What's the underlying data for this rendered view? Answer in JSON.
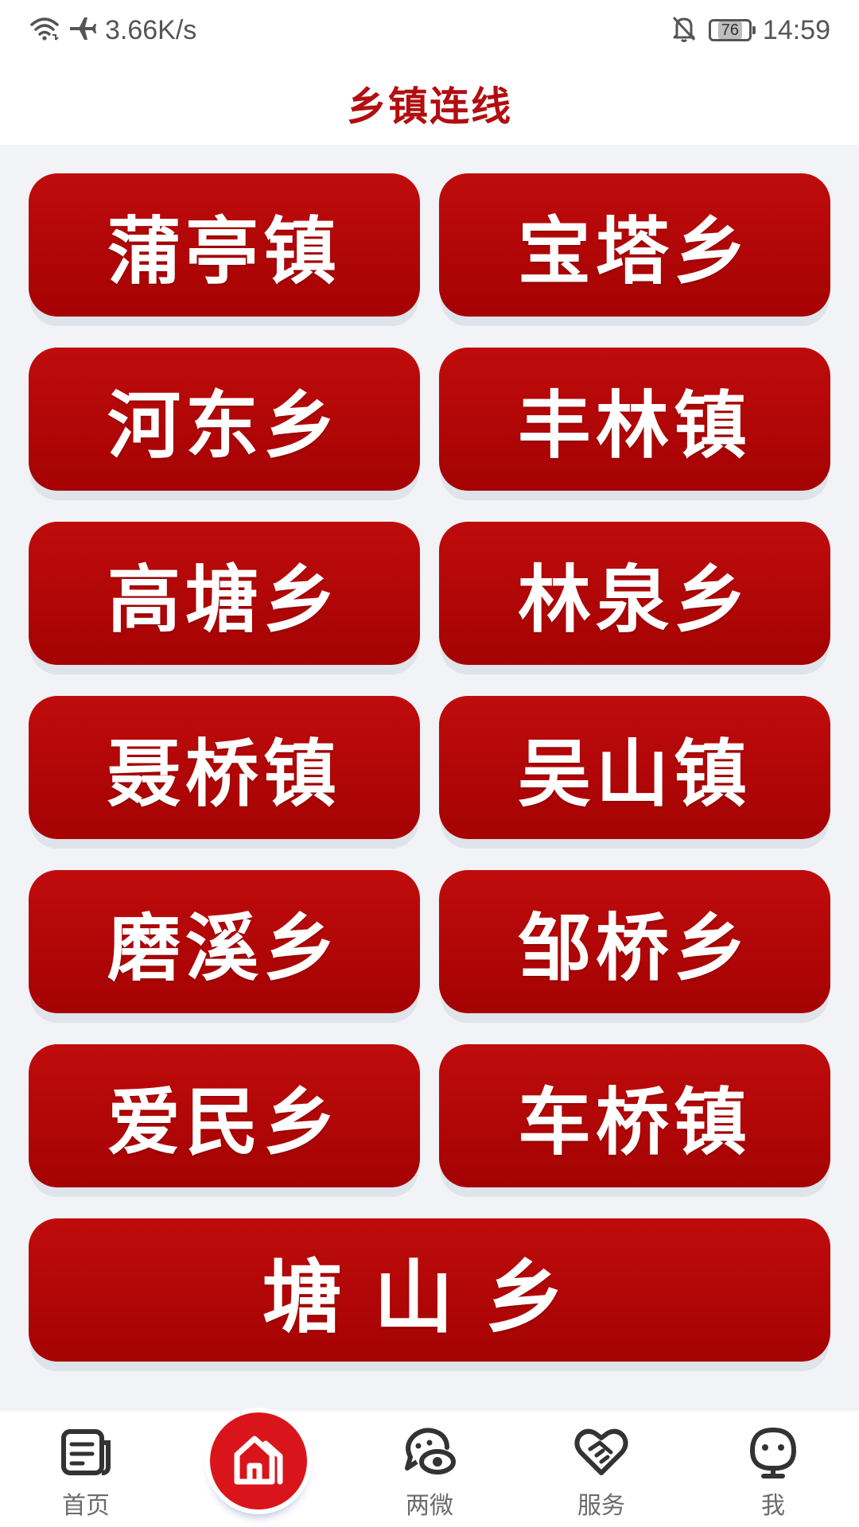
{
  "status_bar": {
    "network_speed": "3.66K/s",
    "battery": "76",
    "time": "14:59",
    "icons": [
      "wifi-icon",
      "airplane-icon",
      "bell-muted-icon",
      "battery-icon"
    ]
  },
  "header": {
    "title": "乡镇连线"
  },
  "towns": [
    {
      "label": "蒲亭镇"
    },
    {
      "label": "宝塔乡"
    },
    {
      "label": "河东乡"
    },
    {
      "label": "丰林镇"
    },
    {
      "label": "高塘乡"
    },
    {
      "label": "林泉乡"
    },
    {
      "label": "聂桥镇"
    },
    {
      "label": "吴山镇"
    },
    {
      "label": "磨溪乡"
    },
    {
      "label": "邹桥乡"
    },
    {
      "label": "爱民乡"
    },
    {
      "label": "车桥镇"
    },
    {
      "label": "塘山乡"
    }
  ],
  "tabs": [
    {
      "label": "首页",
      "icon": "news-icon"
    },
    {
      "label": "",
      "icon": "home-icon"
    },
    {
      "label": "两微",
      "icon": "chat-eye-icon"
    },
    {
      "label": "服务",
      "icon": "handshake-heart-icon"
    },
    {
      "label": "我",
      "icon": "user-icon"
    }
  ],
  "colors": {
    "accent": "#b20e10",
    "button_top": "#bf0c0c",
    "button_bottom": "#a50203",
    "fab": "#d9151b",
    "background": "#f1f3f7"
  }
}
